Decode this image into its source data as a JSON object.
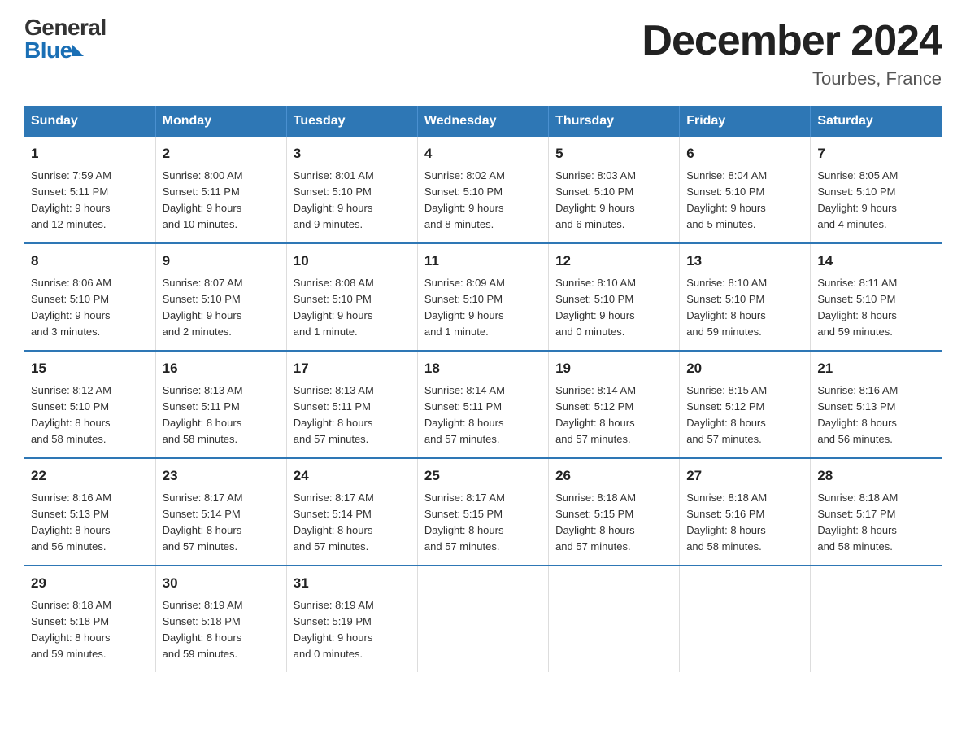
{
  "header": {
    "logo_general": "General",
    "logo_blue": "Blue",
    "month_title": "December 2024",
    "location": "Tourbes, France"
  },
  "days_of_week": [
    "Sunday",
    "Monday",
    "Tuesday",
    "Wednesday",
    "Thursday",
    "Friday",
    "Saturday"
  ],
  "weeks": [
    [
      {
        "day": "1",
        "sunrise": "7:59 AM",
        "sunset": "5:11 PM",
        "daylight": "9 hours and 12 minutes."
      },
      {
        "day": "2",
        "sunrise": "8:00 AM",
        "sunset": "5:11 PM",
        "daylight": "9 hours and 10 minutes."
      },
      {
        "day": "3",
        "sunrise": "8:01 AM",
        "sunset": "5:10 PM",
        "daylight": "9 hours and 9 minutes."
      },
      {
        "day": "4",
        "sunrise": "8:02 AM",
        "sunset": "5:10 PM",
        "daylight": "9 hours and 8 minutes."
      },
      {
        "day": "5",
        "sunrise": "8:03 AM",
        "sunset": "5:10 PM",
        "daylight": "9 hours and 6 minutes."
      },
      {
        "day": "6",
        "sunrise": "8:04 AM",
        "sunset": "5:10 PM",
        "daylight": "9 hours and 5 minutes."
      },
      {
        "day": "7",
        "sunrise": "8:05 AM",
        "sunset": "5:10 PM",
        "daylight": "9 hours and 4 minutes."
      }
    ],
    [
      {
        "day": "8",
        "sunrise": "8:06 AM",
        "sunset": "5:10 PM",
        "daylight": "9 hours and 3 minutes."
      },
      {
        "day": "9",
        "sunrise": "8:07 AM",
        "sunset": "5:10 PM",
        "daylight": "9 hours and 2 minutes."
      },
      {
        "day": "10",
        "sunrise": "8:08 AM",
        "sunset": "5:10 PM",
        "daylight": "9 hours and 1 minute."
      },
      {
        "day": "11",
        "sunrise": "8:09 AM",
        "sunset": "5:10 PM",
        "daylight": "9 hours and 1 minute."
      },
      {
        "day": "12",
        "sunrise": "8:10 AM",
        "sunset": "5:10 PM",
        "daylight": "9 hours and 0 minutes."
      },
      {
        "day": "13",
        "sunrise": "8:10 AM",
        "sunset": "5:10 PM",
        "daylight": "8 hours and 59 minutes."
      },
      {
        "day": "14",
        "sunrise": "8:11 AM",
        "sunset": "5:10 PM",
        "daylight": "8 hours and 59 minutes."
      }
    ],
    [
      {
        "day": "15",
        "sunrise": "8:12 AM",
        "sunset": "5:10 PM",
        "daylight": "8 hours and 58 minutes."
      },
      {
        "day": "16",
        "sunrise": "8:13 AM",
        "sunset": "5:11 PM",
        "daylight": "8 hours and 58 minutes."
      },
      {
        "day": "17",
        "sunrise": "8:13 AM",
        "sunset": "5:11 PM",
        "daylight": "8 hours and 57 minutes."
      },
      {
        "day": "18",
        "sunrise": "8:14 AM",
        "sunset": "5:11 PM",
        "daylight": "8 hours and 57 minutes."
      },
      {
        "day": "19",
        "sunrise": "8:14 AM",
        "sunset": "5:12 PM",
        "daylight": "8 hours and 57 minutes."
      },
      {
        "day": "20",
        "sunrise": "8:15 AM",
        "sunset": "5:12 PM",
        "daylight": "8 hours and 57 minutes."
      },
      {
        "day": "21",
        "sunrise": "8:16 AM",
        "sunset": "5:13 PM",
        "daylight": "8 hours and 56 minutes."
      }
    ],
    [
      {
        "day": "22",
        "sunrise": "8:16 AM",
        "sunset": "5:13 PM",
        "daylight": "8 hours and 56 minutes."
      },
      {
        "day": "23",
        "sunrise": "8:17 AM",
        "sunset": "5:14 PM",
        "daylight": "8 hours and 57 minutes."
      },
      {
        "day": "24",
        "sunrise": "8:17 AM",
        "sunset": "5:14 PM",
        "daylight": "8 hours and 57 minutes."
      },
      {
        "day": "25",
        "sunrise": "8:17 AM",
        "sunset": "5:15 PM",
        "daylight": "8 hours and 57 minutes."
      },
      {
        "day": "26",
        "sunrise": "8:18 AM",
        "sunset": "5:15 PM",
        "daylight": "8 hours and 57 minutes."
      },
      {
        "day": "27",
        "sunrise": "8:18 AM",
        "sunset": "5:16 PM",
        "daylight": "8 hours and 58 minutes."
      },
      {
        "day": "28",
        "sunrise": "8:18 AM",
        "sunset": "5:17 PM",
        "daylight": "8 hours and 58 minutes."
      }
    ],
    [
      {
        "day": "29",
        "sunrise": "8:18 AM",
        "sunset": "5:18 PM",
        "daylight": "8 hours and 59 minutes."
      },
      {
        "day": "30",
        "sunrise": "8:19 AM",
        "sunset": "5:18 PM",
        "daylight": "8 hours and 59 minutes."
      },
      {
        "day": "31",
        "sunrise": "8:19 AM",
        "sunset": "5:19 PM",
        "daylight": "9 hours and 0 minutes."
      },
      null,
      null,
      null,
      null
    ]
  ],
  "labels": {
    "sunrise": "Sunrise:",
    "sunset": "Sunset:",
    "daylight": "Daylight:"
  }
}
